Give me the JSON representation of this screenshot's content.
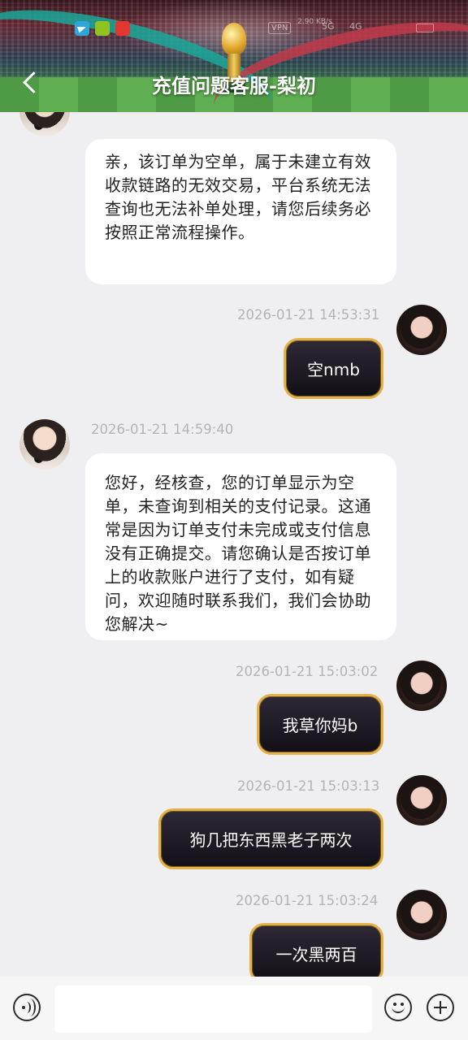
{
  "header": {
    "title": "充值问题客服-梨初",
    "back_icon": "chevron-left-icon"
  },
  "status_bar": {
    "vpn": "VPN",
    "network_speed": "2.90 KB/s",
    "network_type_1": "5G",
    "network_type_2": "4G"
  },
  "messages": [
    {
      "sender": "agent",
      "text": "亲，该订单为空单，属于未建立有效收款链路的无效交易，平台系统无法查询也无法补单处理，请您后续务必按照正常流程操作。"
    },
    {
      "sender": "user",
      "timestamp": "2026-01-21 14:53:31",
      "text": "空nmb"
    },
    {
      "sender": "agent",
      "timestamp": "2026-01-21 14:59:40",
      "text": "您好，经核查，您的订单显示为空单，未查询到相关的支付记录。这通常是因为订单支付未完成或支付信息没有正确提交。请您确认是否按订单上的收款账户进行了支付，如有疑问，欢迎随时联系我们，我们会协助您解决~"
    },
    {
      "sender": "user",
      "timestamp": "2026-01-21 15:03:02",
      "text": "我草你妈b"
    },
    {
      "sender": "user",
      "timestamp": "2026-01-21 15:03:13",
      "text": "狗几把东西黑老子两次"
    },
    {
      "sender": "user",
      "timestamp": "2026-01-21 15:03:24",
      "text": "一次黑两百"
    }
  ],
  "input_bar": {
    "placeholder": "",
    "voice_icon": "voice-icon",
    "emoji_icon": "emoji-icon",
    "plus_icon": "plus-icon"
  }
}
